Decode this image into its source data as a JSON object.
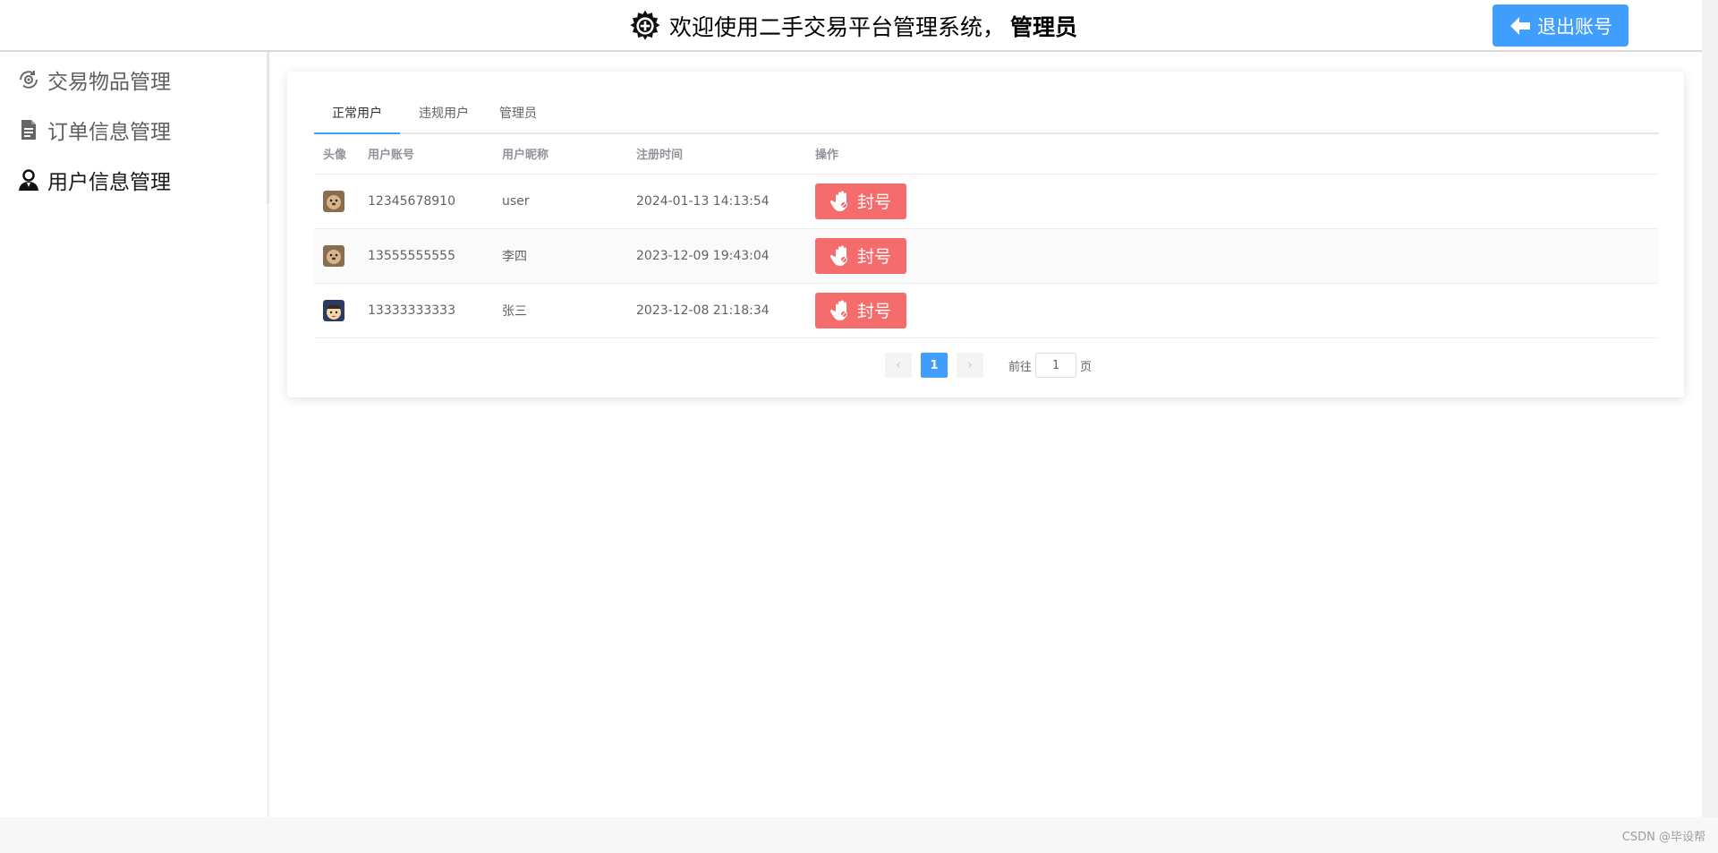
{
  "header": {
    "title": "欢迎使用二手交易平台管理系统，",
    "admin_name": "管理员",
    "logout_label": "退出账号",
    "icon": "gear-icon"
  },
  "sidebar": {
    "items": [
      {
        "label": "交易物品管理",
        "icon": "refresh-eye-icon",
        "active": false
      },
      {
        "label": "订单信息管理",
        "icon": "document-icon",
        "active": false
      },
      {
        "label": "用户信息管理",
        "icon": "user-icon",
        "active": true
      }
    ]
  },
  "tabs": [
    {
      "label": "正常用户",
      "active": true
    },
    {
      "label": "违规用户",
      "active": false
    },
    {
      "label": "管理员",
      "active": false
    }
  ],
  "table": {
    "headers": [
      "头像",
      "用户账号",
      "用户昵称",
      "注册时间",
      "操作"
    ],
    "rows": [
      {
        "account": "12345678910",
        "nickname": "user",
        "registered": "2024-01-13 14:13:54",
        "action": "封号",
        "avatar": "dog-avatar"
      },
      {
        "account": "13555555555",
        "nickname": "李四",
        "registered": "2023-12-09 19:43:04",
        "action": "封号",
        "avatar": "dog-avatar"
      },
      {
        "account": "13333333333",
        "nickname": "张三",
        "registered": "2023-12-08 21:18:34",
        "action": "封号",
        "avatar": "cartoon-avatar"
      }
    ]
  },
  "pagination": {
    "current_page": "1",
    "jump_prefix": "前往",
    "jump_value": "1",
    "jump_suffix": "页"
  },
  "watermark": "CSDN @毕设帮",
  "colors": {
    "primary": "#409eff",
    "danger": "#f56c6c"
  }
}
